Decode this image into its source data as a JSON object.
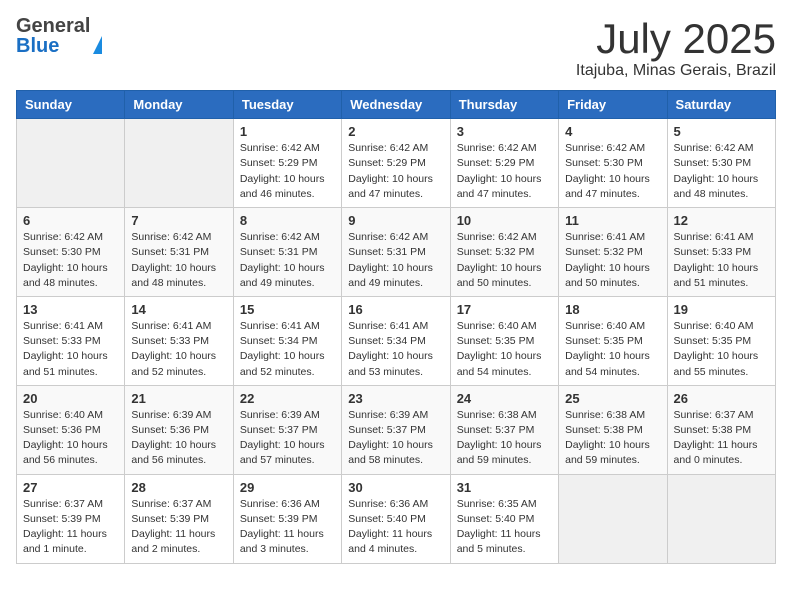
{
  "header": {
    "logo_general": "General",
    "logo_blue": "Blue",
    "title": "July 2025",
    "subtitle": "Itajuba, Minas Gerais, Brazil"
  },
  "days_of_week": [
    "Sunday",
    "Monday",
    "Tuesday",
    "Wednesday",
    "Thursday",
    "Friday",
    "Saturday"
  ],
  "weeks": [
    [
      {
        "day": "",
        "info": ""
      },
      {
        "day": "",
        "info": ""
      },
      {
        "day": "1",
        "info": "Sunrise: 6:42 AM\nSunset: 5:29 PM\nDaylight: 10 hours\nand 46 minutes."
      },
      {
        "day": "2",
        "info": "Sunrise: 6:42 AM\nSunset: 5:29 PM\nDaylight: 10 hours\nand 47 minutes."
      },
      {
        "day": "3",
        "info": "Sunrise: 6:42 AM\nSunset: 5:29 PM\nDaylight: 10 hours\nand 47 minutes."
      },
      {
        "day": "4",
        "info": "Sunrise: 6:42 AM\nSunset: 5:30 PM\nDaylight: 10 hours\nand 47 minutes."
      },
      {
        "day": "5",
        "info": "Sunrise: 6:42 AM\nSunset: 5:30 PM\nDaylight: 10 hours\nand 48 minutes."
      }
    ],
    [
      {
        "day": "6",
        "info": "Sunrise: 6:42 AM\nSunset: 5:30 PM\nDaylight: 10 hours\nand 48 minutes."
      },
      {
        "day": "7",
        "info": "Sunrise: 6:42 AM\nSunset: 5:31 PM\nDaylight: 10 hours\nand 48 minutes."
      },
      {
        "day": "8",
        "info": "Sunrise: 6:42 AM\nSunset: 5:31 PM\nDaylight: 10 hours\nand 49 minutes."
      },
      {
        "day": "9",
        "info": "Sunrise: 6:42 AM\nSunset: 5:31 PM\nDaylight: 10 hours\nand 49 minutes."
      },
      {
        "day": "10",
        "info": "Sunrise: 6:42 AM\nSunset: 5:32 PM\nDaylight: 10 hours\nand 50 minutes."
      },
      {
        "day": "11",
        "info": "Sunrise: 6:41 AM\nSunset: 5:32 PM\nDaylight: 10 hours\nand 50 minutes."
      },
      {
        "day": "12",
        "info": "Sunrise: 6:41 AM\nSunset: 5:33 PM\nDaylight: 10 hours\nand 51 minutes."
      }
    ],
    [
      {
        "day": "13",
        "info": "Sunrise: 6:41 AM\nSunset: 5:33 PM\nDaylight: 10 hours\nand 51 minutes."
      },
      {
        "day": "14",
        "info": "Sunrise: 6:41 AM\nSunset: 5:33 PM\nDaylight: 10 hours\nand 52 minutes."
      },
      {
        "day": "15",
        "info": "Sunrise: 6:41 AM\nSunset: 5:34 PM\nDaylight: 10 hours\nand 52 minutes."
      },
      {
        "day": "16",
        "info": "Sunrise: 6:41 AM\nSunset: 5:34 PM\nDaylight: 10 hours\nand 53 minutes."
      },
      {
        "day": "17",
        "info": "Sunrise: 6:40 AM\nSunset: 5:35 PM\nDaylight: 10 hours\nand 54 minutes."
      },
      {
        "day": "18",
        "info": "Sunrise: 6:40 AM\nSunset: 5:35 PM\nDaylight: 10 hours\nand 54 minutes."
      },
      {
        "day": "19",
        "info": "Sunrise: 6:40 AM\nSunset: 5:35 PM\nDaylight: 10 hours\nand 55 minutes."
      }
    ],
    [
      {
        "day": "20",
        "info": "Sunrise: 6:40 AM\nSunset: 5:36 PM\nDaylight: 10 hours\nand 56 minutes."
      },
      {
        "day": "21",
        "info": "Sunrise: 6:39 AM\nSunset: 5:36 PM\nDaylight: 10 hours\nand 56 minutes."
      },
      {
        "day": "22",
        "info": "Sunrise: 6:39 AM\nSunset: 5:37 PM\nDaylight: 10 hours\nand 57 minutes."
      },
      {
        "day": "23",
        "info": "Sunrise: 6:39 AM\nSunset: 5:37 PM\nDaylight: 10 hours\nand 58 minutes."
      },
      {
        "day": "24",
        "info": "Sunrise: 6:38 AM\nSunset: 5:37 PM\nDaylight: 10 hours\nand 59 minutes."
      },
      {
        "day": "25",
        "info": "Sunrise: 6:38 AM\nSunset: 5:38 PM\nDaylight: 10 hours\nand 59 minutes."
      },
      {
        "day": "26",
        "info": "Sunrise: 6:37 AM\nSunset: 5:38 PM\nDaylight: 11 hours\nand 0 minutes."
      }
    ],
    [
      {
        "day": "27",
        "info": "Sunrise: 6:37 AM\nSunset: 5:39 PM\nDaylight: 11 hours\nand 1 minute."
      },
      {
        "day": "28",
        "info": "Sunrise: 6:37 AM\nSunset: 5:39 PM\nDaylight: 11 hours\nand 2 minutes."
      },
      {
        "day": "29",
        "info": "Sunrise: 6:36 AM\nSunset: 5:39 PM\nDaylight: 11 hours\nand 3 minutes."
      },
      {
        "day": "30",
        "info": "Sunrise: 6:36 AM\nSunset: 5:40 PM\nDaylight: 11 hours\nand 4 minutes."
      },
      {
        "day": "31",
        "info": "Sunrise: 6:35 AM\nSunset: 5:40 PM\nDaylight: 11 hours\nand 5 minutes."
      },
      {
        "day": "",
        "info": ""
      },
      {
        "day": "",
        "info": ""
      }
    ]
  ]
}
